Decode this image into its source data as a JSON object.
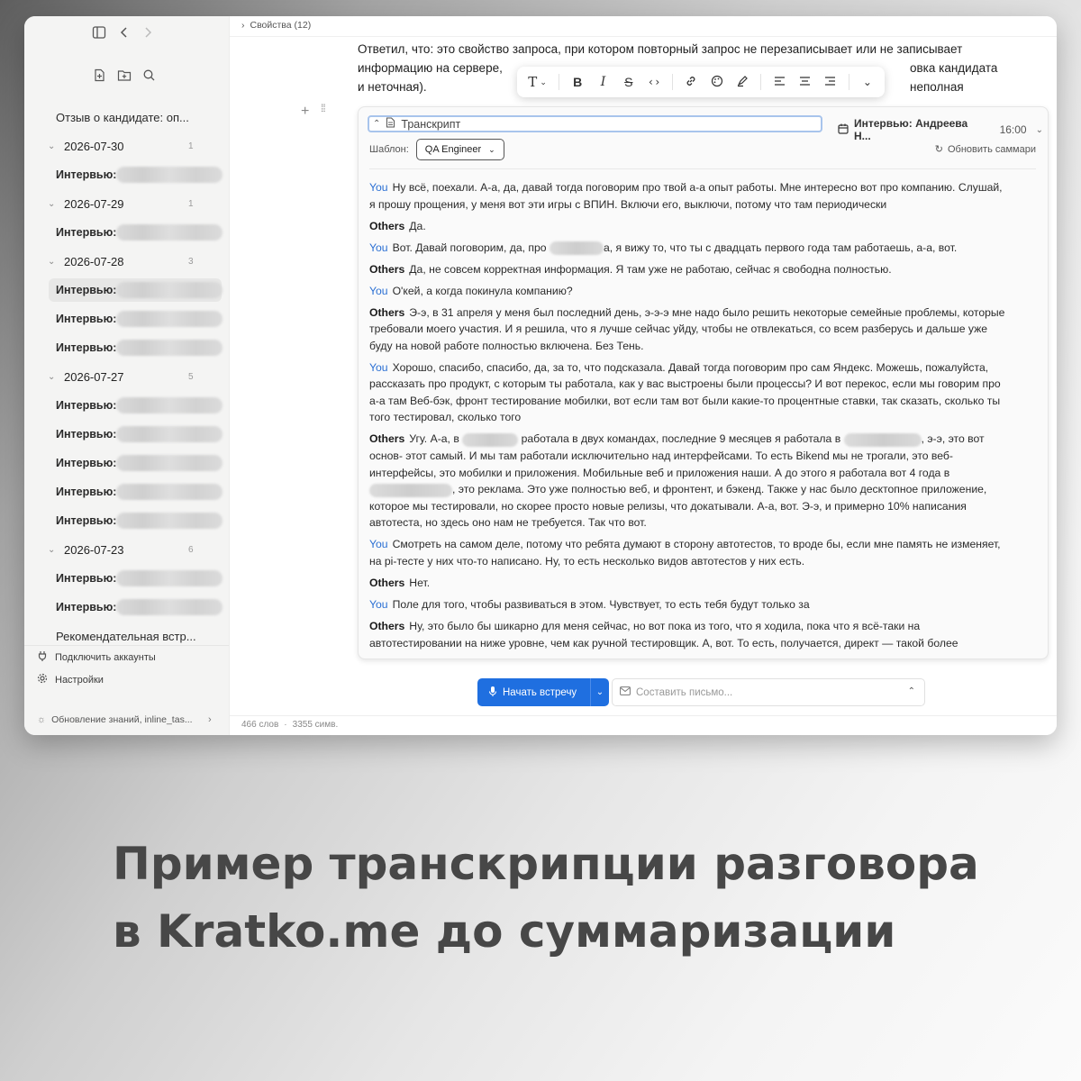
{
  "sidebar": {
    "tree": {
      "top_note": "Отзыв о кандидате: оп...",
      "groups": [
        {
          "date": "2026-07-30",
          "count": "1",
          "items": [
            {
              "label": "Интервью:"
            }
          ]
        },
        {
          "date": "2026-07-29",
          "count": "1",
          "items": [
            {
              "label": "Интервью:"
            }
          ]
        },
        {
          "date": "2026-07-28",
          "count": "3",
          "items": [
            {
              "label": "Интервью:"
            },
            {
              "label": "Интервью:"
            },
            {
              "label": "Интервью:"
            }
          ]
        },
        {
          "date": "2026-07-27",
          "count": "5",
          "items": [
            {
              "label": "Интервью:"
            },
            {
              "label": "Интервью:"
            },
            {
              "label": "Интервью:"
            },
            {
              "label": "Интервью:"
            },
            {
              "label": "Интервью:"
            }
          ]
        },
        {
          "date": "2026-07-23",
          "count": "6",
          "items": [
            {
              "label": "Интервью:"
            },
            {
              "label": "Интервью:"
            }
          ]
        }
      ],
      "bottom_note": "Рекомендательная встр..."
    },
    "connect_accounts": "Подключить аккаунты",
    "settings": "Настройки",
    "status": "Обновление знаний, inline_tas..."
  },
  "main": {
    "properties": "Свойства (12)",
    "paragraph": {
      "line1": "Ответил, что: это свойство запроса, при котором повторный запрос не перезаписывает или не записывает",
      "line2_left": "информацию на сервере, ",
      "line2_right": "овка кандидата неполная",
      "line3": "и неточная)."
    },
    "toolbar": {
      "items": [
        "text-style",
        "bold",
        "italic",
        "strikethrough",
        "code",
        "link",
        "color",
        "highlight",
        "align-left",
        "align-center",
        "align-right",
        "more"
      ]
    },
    "card": {
      "title": "Транскрипт",
      "meeting": "Интервью: Андреева Н...",
      "time": "16:00",
      "template_label": "Шаблон:",
      "template_value": "QA Engineer",
      "refresh": "Обновить саммари",
      "messages": [
        {
          "speaker": "You",
          "text": "Ну всё, поехали. А-а, да, давай тогда поговорим про твой а-а опыт работы. Мне интересно вот про компанию. Слушай, я прошу прощения, у меня вот эти игры с ВПИН. Включи его, выключи, потому что там периодически"
        },
        {
          "speaker": "Others",
          "text": "Да."
        },
        {
          "speaker": "You",
          "text_before": "Вот. Давай поговорим, да, про ",
          "text_after": "а, я вижу то, что ты с двадцать первого года там работаешь, а-а, вот."
        },
        {
          "speaker": "Others",
          "text": "Да, не совсем корректная информация. Я там уже не работаю, сейчас я свободна полностью."
        },
        {
          "speaker": "You",
          "text": "О'кей, а когда покинула компанию?"
        },
        {
          "speaker": "Others",
          "text": "Э-э, в 31 апреля у меня был последний день, э-э-э мне надо было решить некоторые семейные проблемы, которые требовали моего участия. И я решила, что я лучше сейчас уйду, чтобы не отвлекаться, со всем разберусь и дальше уже буду на новой работе полностью включена. Без Тень."
        },
        {
          "speaker": "You",
          "text": "Хорошо, спасибо, спасибо, да, за то, что подсказала. Давай тогда поговорим про сам Яндекс. Можешь, пожалуйста, рассказать про продукт, с которым ты работала, как у вас выстроены были процессы? И вот перекос, если мы говорим про а-а там Веб-бэк, фронт тестирование мобилки, вот если там вот были какие-то процентные ставки, так сказать, сколько ты того тестировал, сколько того"
        },
        {
          "speaker": "Others",
          "part1": "Угу. А-а, в ",
          "part2": " работала в двух командах, последние 9 месяцев я работала в ",
          "part3": ", э-э, это вот основ- этот самый. И мы там работали исключительно над интерфейсами. То есть Bikend мы не трогали, это веб-интерфейсы, это мобилки и приложения. Мобильные веб и приложения наши. А до этого я работала вот 4 года в ",
          "part4": ", это реклама. Это уже полностью веб, и фронтент, и бэкенд. Также у нас было десктопное приложение, которое мы тестировали, но скорее просто новые релизы, что докатывали. А-а, вот. Э-э, и примерно 10% написания автотеста, но здесь оно нам не требуется. Так что вот."
        },
        {
          "speaker": "You",
          "text": "Смотреть на самом деле, потому что ребята думают в сторону автотестов, то вроде бы, если мне память не изменяет, на pi-тесте у них что-то написано. Ну, то есть несколько видов автотестов у них есть."
        },
        {
          "speaker": "Others",
          "text": "Нет."
        },
        {
          "speaker": "You",
          "text": "Поле для того, чтобы развиваться в этом. Чувствует, то есть тебя будут только за"
        },
        {
          "speaker": "Others",
          "text": "Ну, это было бы шикарно для меня сейчас, но вот пока из того, что я ходила, пока что я всё-таки на автотестировании на ниже уровне, чем как ручной тестировщик. А, вот. То есть, получается, директ — такой более"
        }
      ]
    },
    "start_meeting": "Начать встречу",
    "compose_placeholder": "Составить письмо...",
    "status": {
      "words": "466 слов",
      "chars": "3355 симв."
    }
  },
  "caption": {
    "line1": "Пример транскрипции разговора",
    "line2": "в Kratko.me до суммаризации"
  },
  "colors": {
    "accent": "#1f6fe0",
    "you_speaker": "#2a6fd3",
    "caption": "#474747"
  }
}
